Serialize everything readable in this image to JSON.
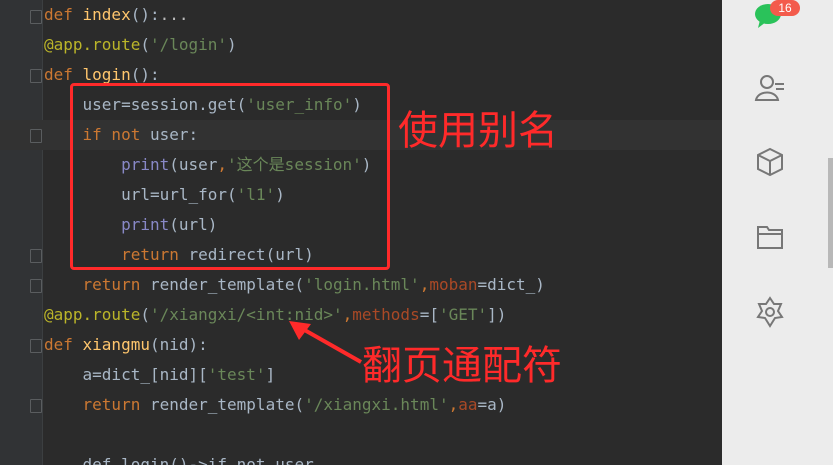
{
  "editor": {
    "lines": [
      [
        [
          "kw",
          "def "
        ],
        [
          "fn",
          "index"
        ],
        [
          "",
          "():"
        ],
        [
          "fold",
          "..."
        ]
      ],
      [
        [
          "dec",
          "@app.route"
        ],
        [
          "",
          "("
        ],
        [
          "str",
          "'/login'"
        ],
        [
          "",
          ")"
        ]
      ],
      [
        [
          "kw",
          "def "
        ],
        [
          "fn",
          "login"
        ],
        [
          "",
          "():"
        ]
      ],
      [
        [
          "",
          "    user=session.get("
        ],
        [
          "str",
          "'user_info'"
        ],
        [
          "",
          ")"
        ]
      ],
      [
        [
          "",
          "    "
        ],
        [
          "kw",
          "if not "
        ],
        [
          "",
          "user:"
        ]
      ],
      [
        [
          "",
          "        "
        ],
        [
          "bi",
          "print"
        ],
        [
          "",
          "(user"
        ],
        [
          "kw",
          ","
        ],
        [
          "str",
          "'这个是session'"
        ],
        [
          "",
          ")"
        ]
      ],
      [
        [
          "",
          "        url=url_for("
        ],
        [
          "str",
          "'l1'"
        ],
        [
          "",
          ")"
        ]
      ],
      [
        [
          "",
          "        "
        ],
        [
          "bi",
          "print"
        ],
        [
          "",
          "(url)"
        ]
      ],
      [
        [
          "",
          "        "
        ],
        [
          "kw",
          "return "
        ],
        [
          "",
          "redirect(url)"
        ]
      ],
      [
        [
          "",
          "    "
        ],
        [
          "kw",
          "return "
        ],
        [
          "",
          "render_template("
        ],
        [
          "str",
          "'login.html'"
        ],
        [
          "kw",
          ","
        ],
        [
          "param",
          "moban"
        ],
        [
          "",
          "=dict_)"
        ]
      ],
      [
        [
          "dec",
          "@app.route"
        ],
        [
          "",
          "("
        ],
        [
          "str",
          "'/xiangxi/<int:nid>'"
        ],
        [
          "kw",
          ","
        ],
        [
          "param",
          "methods"
        ],
        [
          "",
          "=["
        ],
        [
          "str",
          "'GET'"
        ],
        [
          "",
          "])"
        ]
      ],
      [
        [
          "kw",
          "def "
        ],
        [
          "fn",
          "xiangmu"
        ],
        [
          "",
          "(nid):"
        ]
      ],
      [
        [
          "",
          "    a=dict_[nid]["
        ],
        [
          "str",
          "'test'"
        ],
        [
          "",
          "]"
        ]
      ],
      [
        [
          "",
          "    "
        ],
        [
          "kw",
          "return "
        ],
        [
          "",
          "render_template("
        ],
        [
          "str",
          "'/xiangxi.html'"
        ],
        [
          "kw",
          ","
        ],
        [
          "param",
          "aa"
        ],
        [
          "",
          "=a)"
        ]
      ],
      [
        [
          "",
          ""
        ]
      ],
      [
        [
          "",
          "    def login()->if not user"
        ]
      ]
    ]
  },
  "annotations": {
    "alias": "使用别名",
    "wildcard": "翻页通配符"
  },
  "sidebar": {
    "badge": "16",
    "icons": [
      "wechat-icon",
      "contacts-icon",
      "cube-icon",
      "folder-icon",
      "mini-program-icon"
    ]
  },
  "colors": {
    "background": "#2b2b2b",
    "keyword": "#cc7832",
    "function": "#ffc66d",
    "string": "#6a8759",
    "decorator": "#bbb529",
    "annotation": "#ff2a2a",
    "sidebar": "#ececec"
  }
}
